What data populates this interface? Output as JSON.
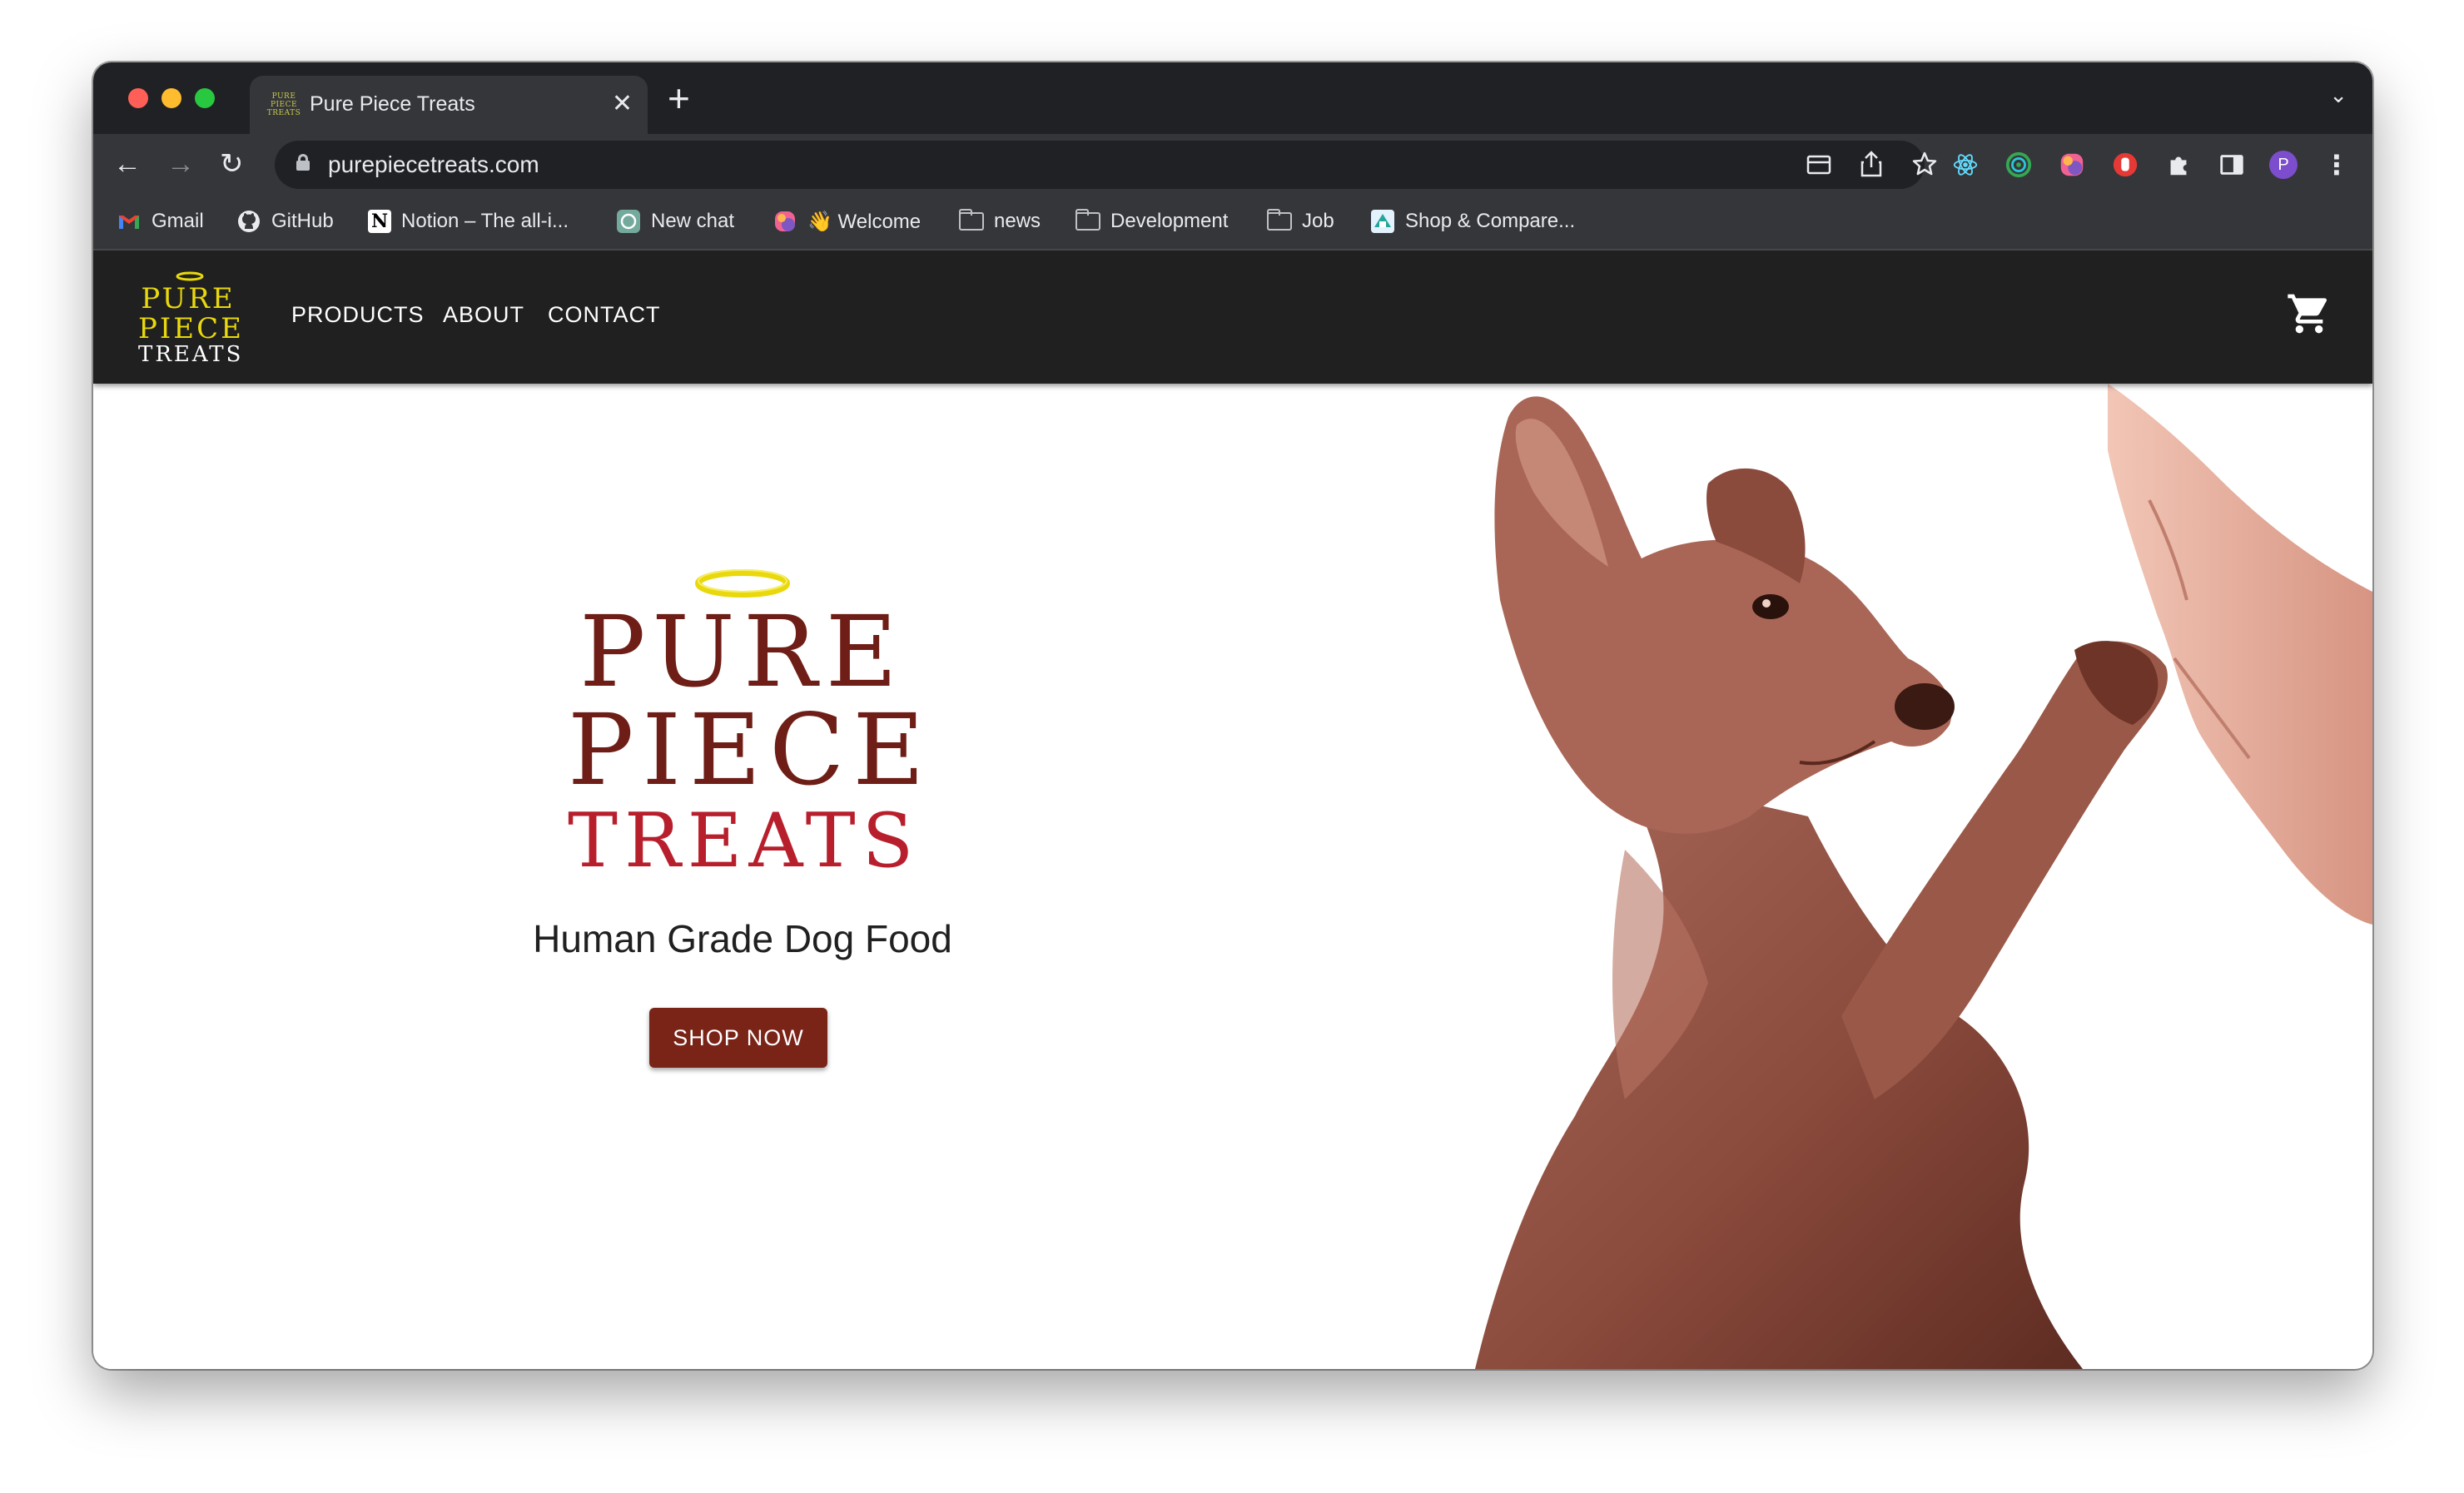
{
  "browser": {
    "tab": {
      "title": "Pure Piece Treats",
      "close_glyph": "✕",
      "favicon_lines": [
        "PURE",
        "PIECE",
        "TREATS"
      ]
    },
    "new_tab_glyph": "+",
    "tab_menu_glyph": "⌄",
    "nav": {
      "back_glyph": "←",
      "forward_glyph": "→",
      "reload_glyph": "↻"
    },
    "url": "purepiecetreats.com",
    "omnibox_icons": [
      "card-icon",
      "share-icon",
      "star-icon"
    ],
    "extensions": [
      "react-devtools-icon",
      "target-extension-icon",
      "colorful-extension-icon",
      "red-hand-extension-icon",
      "puzzle-extensions-icon",
      "side-panel-icon"
    ],
    "profile_initial": "P",
    "menu_glyph": "⋮",
    "bookmarks": [
      {
        "label": "Gmail",
        "icon": "gmail-icon"
      },
      {
        "label": "GitHub",
        "icon": "github-icon"
      },
      {
        "label": "Notion – The all-i...",
        "icon": "notion-icon"
      },
      {
        "label": "New chat",
        "icon": "chatgpt-icon"
      },
      {
        "label": "👋 Welcome",
        "icon": "colorful-app-icon"
      },
      {
        "label": "news",
        "icon": "folder-icon"
      },
      {
        "label": "Development",
        "icon": "folder-icon"
      },
      {
        "label": "Job",
        "icon": "folder-icon"
      },
      {
        "label": "Shop & Compare...",
        "icon": "shop-compare-icon"
      }
    ]
  },
  "site": {
    "logo_lines": [
      "PURE",
      "PIECE",
      "TREATS"
    ],
    "nav": [
      "PRODUCTS",
      "ABOUT",
      "CONTACT"
    ],
    "cart_icon": "shopping-cart-icon",
    "hero": {
      "logo_lines": [
        "PURE",
        "PIECE",
        "TREATS"
      ],
      "tagline": "Human Grade Dog Food",
      "cta": "SHOP NOW"
    },
    "colors": {
      "header_bg": "#202020",
      "brand_dark_red": "#6e1e16",
      "brand_red": "#b81f2c",
      "halo_yellow": "#e8d80c",
      "cta_bg": "#7a2418"
    }
  }
}
